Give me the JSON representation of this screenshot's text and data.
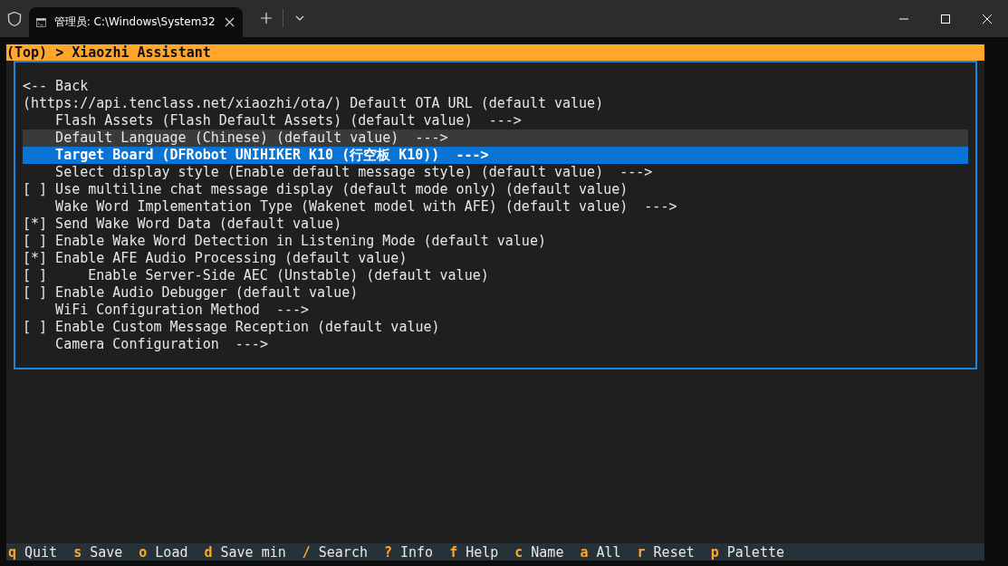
{
  "window": {
    "tab_title": "管理员: C:\\Windows\\System32"
  },
  "breadcrumb": "(Top) > Xiaozhi Assistant",
  "checkbox_glyphs": {
    "checked": "[*]",
    "unchecked": "[ ]"
  },
  "menu": [
    {
      "kind": "plain",
      "label": "<-- Back",
      "selected": false,
      "hovered": false
    },
    {
      "kind": "plain",
      "label": "(https://api.tenclass.net/xiaozhi/ota/) Default OTA URL (default value)",
      "selected": false,
      "hovered": false
    },
    {
      "kind": "menu",
      "label": "Flash Assets (Flash Default Assets) (default value)  --->",
      "selected": false,
      "hovered": false
    },
    {
      "kind": "menu",
      "label": "Default Language (Chinese) (default value)  --->",
      "selected": false,
      "hovered": true
    },
    {
      "kind": "menu",
      "label": "Target Board (DFRobot UNIHIKER K10 (行空板 K10))  --->",
      "selected": true,
      "hovered": false
    },
    {
      "kind": "menu",
      "label": "Select display style (Enable default message style) (default value)  --->",
      "selected": false,
      "hovered": false
    },
    {
      "kind": "checkbox",
      "label": "Use multiline chat message display (default mode only) (default value)",
      "checked": false,
      "selected": false,
      "hovered": false
    },
    {
      "kind": "menu",
      "label": "Wake Word Implementation Type (Wakenet model with AFE) (default value)  --->",
      "selected": false,
      "hovered": false
    },
    {
      "kind": "checkbox",
      "label": "Send Wake Word Data (default value)",
      "checked": true,
      "selected": false,
      "hovered": false
    },
    {
      "kind": "checkbox",
      "label": "Enable Wake Word Detection in Listening Mode (default value)",
      "checked": false,
      "selected": false,
      "hovered": false
    },
    {
      "kind": "checkbox",
      "label": "Enable AFE Audio Processing (default value)",
      "checked": true,
      "selected": false,
      "hovered": false,
      "children": [
        {
          "kind": "checkbox",
          "label": "Enable Server-Side AEC (Unstable) (default value)",
          "checked": false,
          "selected": false,
          "hovered": false
        }
      ]
    },
    {
      "kind": "checkbox",
      "label": "Enable Audio Debugger (default value)",
      "checked": false,
      "selected": false,
      "hovered": false
    },
    {
      "kind": "menu",
      "label": "WiFi Configuration Method  --->",
      "selected": false,
      "hovered": false
    },
    {
      "kind": "checkbox",
      "label": "Enable Custom Message Reception (default value)",
      "checked": false,
      "selected": false,
      "hovered": false
    },
    {
      "kind": "menu",
      "label": "Camera Configuration  --->",
      "selected": false,
      "hovered": false
    }
  ],
  "shortcuts": [
    {
      "key": "q",
      "label": "Quit"
    },
    {
      "key": "s",
      "label": "Save"
    },
    {
      "key": "o",
      "label": "Load"
    },
    {
      "key": "d",
      "label": "Save min"
    },
    {
      "key": "/",
      "label": "Search"
    },
    {
      "key": "?",
      "label": "Info"
    },
    {
      "key": "f",
      "label": "Help"
    },
    {
      "key": "c",
      "label": "Name"
    },
    {
      "key": "a",
      "label": "All"
    },
    {
      "key": "r",
      "label": "Reset"
    },
    {
      "key": "p",
      "label": "Palette"
    }
  ]
}
